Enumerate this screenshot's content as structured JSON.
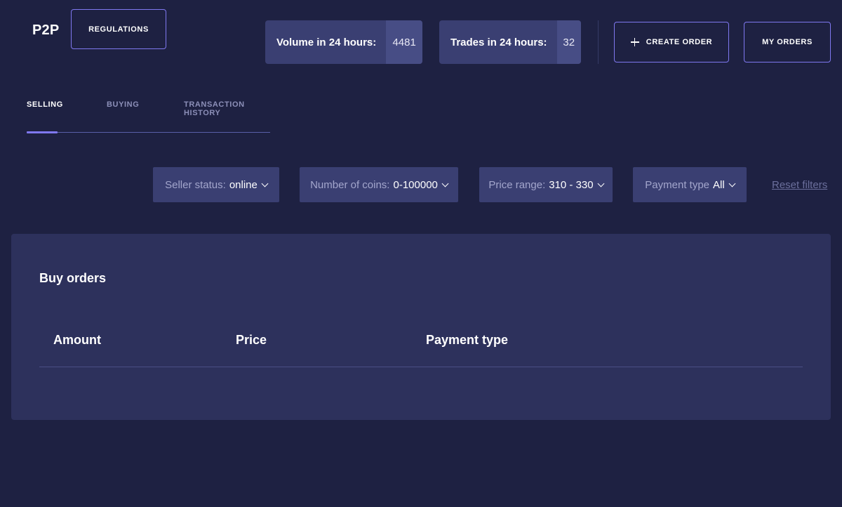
{
  "header": {
    "brand": "P2P",
    "regulations_label": "REGULATIONS",
    "create_order_label": "CREATE ORDER",
    "my_orders_label": "MY ORDERS",
    "stats": {
      "volume_label": "Volume in 24 hours:",
      "volume_value": "4481",
      "trades_label": "Trades in 24 hours:",
      "trades_value": "32"
    }
  },
  "tabs": {
    "selling": "SELLING",
    "buying": "BUYING",
    "history": "TRANSACTION HISTORY",
    "active": "selling"
  },
  "filters": {
    "seller_status": {
      "label": "Seller status:",
      "value": "online"
    },
    "coins": {
      "label": "Number of coins:",
      "value": "0-100000"
    },
    "price": {
      "label": "Price range:",
      "value": "310 - 330"
    },
    "payment": {
      "label": "Payment type",
      "value": "All"
    },
    "reset_label": "Reset filters"
  },
  "orders": {
    "title": "Buy orders",
    "columns": {
      "amount": "Amount",
      "price": "Price",
      "payment": "Payment type"
    }
  },
  "colors": {
    "background": "#1e2142",
    "card": "#2d315c",
    "accent": "#7f78f0",
    "panel": "#3a3f72"
  },
  "icons": {
    "create_order": "plus-icon",
    "filter_dropdown": "chevron-down-icon"
  }
}
